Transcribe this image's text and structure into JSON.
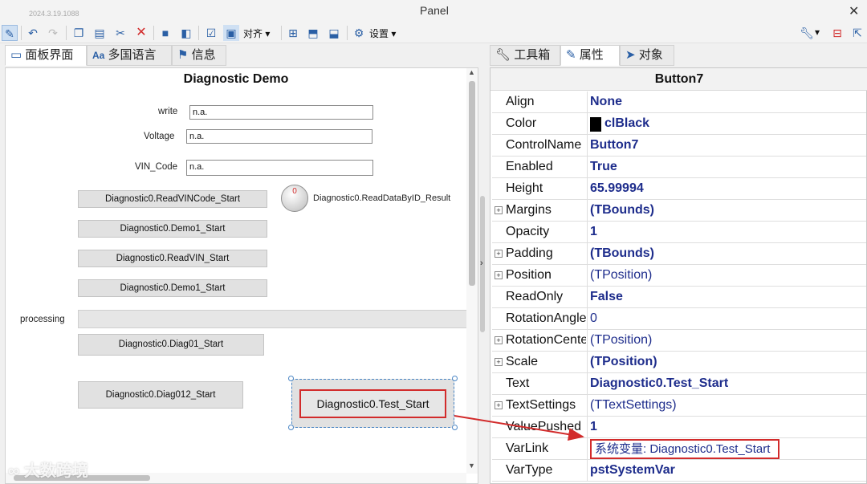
{
  "window": {
    "version": "2024.3.19.1088",
    "title": "Panel",
    "close": "✕"
  },
  "toolbar": {
    "align_label": "对齐",
    "settings_label": "设置"
  },
  "left_tabs": [
    "面板界面",
    "多国语言",
    "信息"
  ],
  "right_tabs": [
    "工具箱",
    "属性",
    "对象"
  ],
  "canvas": {
    "title": "Diagnostic Demo",
    "fields": [
      {
        "label": "write",
        "value": "n.a."
      },
      {
        "label": "Voltage",
        "value": "n.a."
      },
      {
        "label": "VIN_Code",
        "value": "n.a."
      }
    ],
    "buttons": [
      "Diagnostic0.ReadVINCode_Start",
      "Diagnostic0.Demo1_Start",
      "Diagnostic0.ReadVIN_Start",
      "Diagnostic0.Demo1_Start",
      "Diagnostic0.Diag01_Start",
      "Diagnostic0.Diag012_Start",
      "Diagnostic0.Test_Start"
    ],
    "gauge_value": "0",
    "gauge_label": "Diagnostic0.ReadDataByID_Result",
    "processing_label": "processing"
  },
  "inspector": {
    "component": "Button7",
    "properties": [
      {
        "name": "Align",
        "value": "None",
        "bold": true
      },
      {
        "name": "Color",
        "value": "clBlack",
        "bold": true,
        "swatch": "#000000"
      },
      {
        "name": "ControlName",
        "value": "Button7",
        "bold": true
      },
      {
        "name": "Enabled",
        "value": "True",
        "bold": true
      },
      {
        "name": "Height",
        "value": "65.99994",
        "bold": true
      },
      {
        "name": "Margins",
        "value": "(TBounds)",
        "bold": true,
        "expand": true
      },
      {
        "name": "Opacity",
        "value": "1",
        "bold": true
      },
      {
        "name": "Padding",
        "value": "(TBounds)",
        "bold": true,
        "expand": true
      },
      {
        "name": "Position",
        "value": "(TPosition)",
        "bold": false,
        "expand": true
      },
      {
        "name": "ReadOnly",
        "value": "False",
        "bold": true
      },
      {
        "name": "RotationAngle",
        "value": "0",
        "bold": false
      },
      {
        "name": "RotationCenter",
        "value": "(TPosition)",
        "bold": false,
        "expand": true
      },
      {
        "name": "Scale",
        "value": "(TPosition)",
        "bold": true,
        "expand": true
      },
      {
        "name": "Text",
        "value": "Diagnostic0.Test_Start",
        "bold": true
      },
      {
        "name": "TextSettings",
        "value": "(TTextSettings)",
        "bold": false,
        "expand": true
      },
      {
        "name": "ValuePushed",
        "value": "1",
        "bold": true
      },
      {
        "name": "VarLink",
        "value": "系统变量: Diagnostic0.Test_Start",
        "bold": false,
        "highlight": true
      },
      {
        "name": "VarType",
        "value": "pstSystemVar",
        "bold": true
      }
    ]
  },
  "watermark": "大数跨境",
  "colors": {
    "highlight_red": "#d22b2b",
    "value_blue": "#1e2d8c",
    "selection_blue": "#4a86c5"
  }
}
